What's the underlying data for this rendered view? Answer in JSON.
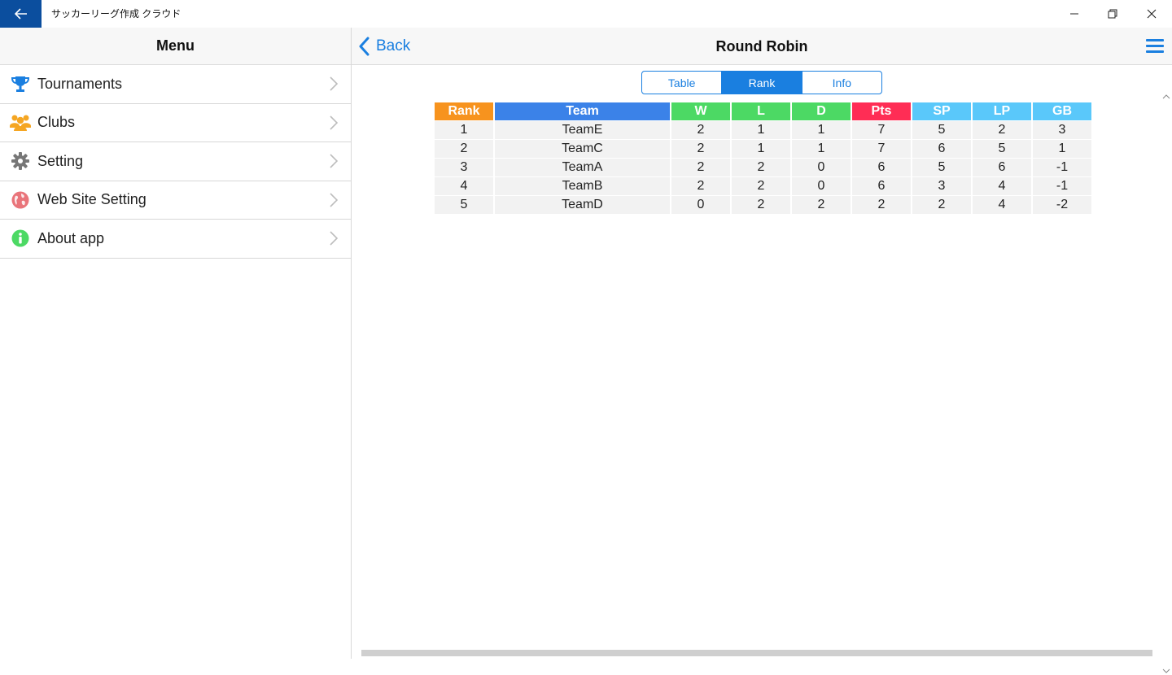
{
  "window": {
    "title": "サッカーリーグ作成 クラウド",
    "back_icon": "arrow-left-icon",
    "controls": [
      "minimize-icon",
      "restore-icon",
      "close-icon"
    ]
  },
  "sidebar": {
    "header": "Menu",
    "items": [
      {
        "label": "Tournaments",
        "icon": "trophy-icon",
        "color": "#1a7fe0"
      },
      {
        "label": "Clubs",
        "icon": "people-icon",
        "color": "#f5a623"
      },
      {
        "label": "Setting",
        "icon": "gear-icon",
        "color": "#777777"
      },
      {
        "label": "Web Site Setting",
        "icon": "globe-icon",
        "color": "#e9747a"
      },
      {
        "label": "About app",
        "icon": "info-icon",
        "color": "#4cd964"
      }
    ]
  },
  "nav": {
    "back_label": "Back",
    "title": "Round Robin"
  },
  "segments": {
    "items": [
      "Table",
      "Rank",
      "Info"
    ],
    "active": "Rank"
  },
  "rank_table": {
    "headers": [
      {
        "label": "Rank",
        "color": "#f7931e"
      },
      {
        "label": "Team",
        "color": "#3b82e8"
      },
      {
        "label": "W",
        "color": "#4cd964"
      },
      {
        "label": "L",
        "color": "#4cd964"
      },
      {
        "label": "D",
        "color": "#4cd964"
      },
      {
        "label": "Pts",
        "color": "#ff2d55"
      },
      {
        "label": "SP",
        "color": "#5ac8fa"
      },
      {
        "label": "LP",
        "color": "#5ac8fa"
      },
      {
        "label": "GB",
        "color": "#5ac8fa"
      }
    ],
    "rows": [
      [
        "1",
        "TeamE",
        "2",
        "1",
        "1",
        "7",
        "5",
        "2",
        "3"
      ],
      [
        "2",
        "TeamC",
        "2",
        "1",
        "1",
        "7",
        "6",
        "5",
        "1"
      ],
      [
        "3",
        "TeamA",
        "2",
        "2",
        "0",
        "6",
        "5",
        "6",
        "-1"
      ],
      [
        "4",
        "TeamB",
        "2",
        "2",
        "0",
        "6",
        "3",
        "4",
        "-1"
      ],
      [
        "5",
        "TeamD",
        "0",
        "2",
        "2",
        "2",
        "2",
        "4",
        "-2"
      ]
    ]
  }
}
